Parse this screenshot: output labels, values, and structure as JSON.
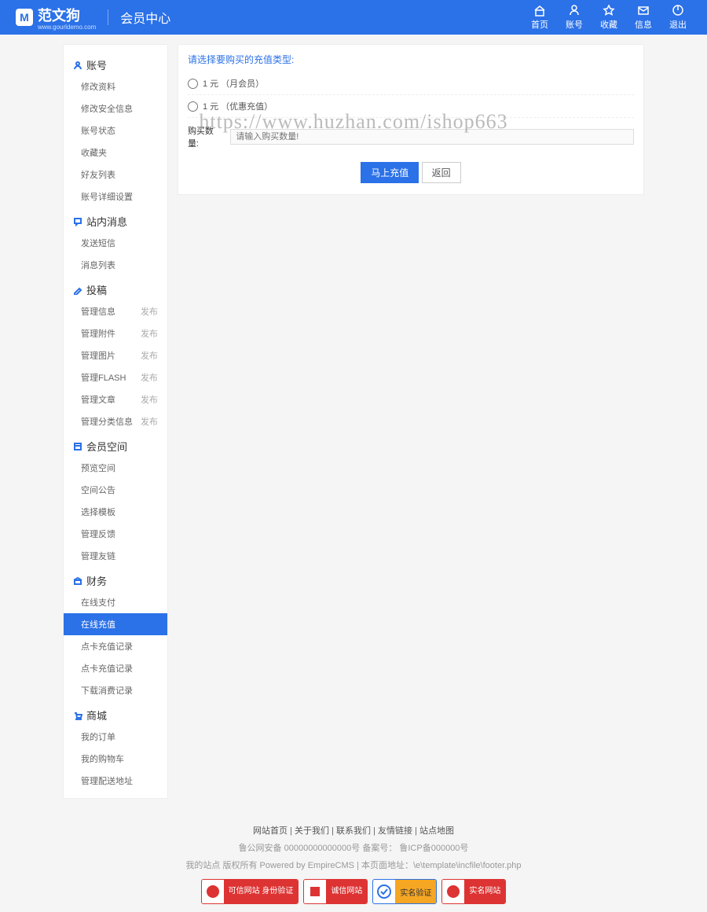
{
  "header": {
    "logo_text": "范文狗",
    "logo_sub": "www.gourldemo.com",
    "page_title": "会员中心",
    "nav": [
      {
        "label": "首页",
        "icon": "home"
      },
      {
        "label": "账号",
        "icon": "user"
      },
      {
        "label": "收藏",
        "icon": "star"
      },
      {
        "label": "信息",
        "icon": "mail"
      },
      {
        "label": "退出",
        "icon": "power"
      }
    ]
  },
  "sidebar": [
    {
      "title": "账号",
      "icon": "user",
      "items": [
        {
          "label": "修改资料"
        },
        {
          "label": "修改安全信息"
        },
        {
          "label": "账号状态"
        },
        {
          "label": "收藏夹"
        },
        {
          "label": "好友列表"
        },
        {
          "label": "账号详细设置"
        }
      ]
    },
    {
      "title": "站内消息",
      "icon": "bubble",
      "items": [
        {
          "label": "发送短信"
        },
        {
          "label": "消息列表"
        }
      ]
    },
    {
      "title": "投稿",
      "icon": "edit",
      "items": [
        {
          "label": "管理信息",
          "action": "发布"
        },
        {
          "label": "管理附件",
          "action": "发布"
        },
        {
          "label": "管理图片",
          "action": "发布"
        },
        {
          "label": "管理FLASH",
          "action": "发布"
        },
        {
          "label": "管理文章",
          "action": "发布"
        },
        {
          "label": "管理分类信息",
          "action": "发布"
        }
      ]
    },
    {
      "title": "会员空间",
      "icon": "layout",
      "items": [
        {
          "label": "预览空间"
        },
        {
          "label": "空间公告"
        },
        {
          "label": "选择模板"
        },
        {
          "label": "管理反馈"
        },
        {
          "label": "管理友链"
        }
      ]
    },
    {
      "title": "财务",
      "icon": "bank",
      "items": [
        {
          "label": "在线支付"
        },
        {
          "label": "在线充值",
          "active": true
        },
        {
          "label": "点卡充值记录"
        },
        {
          "label": "点卡充值记录"
        },
        {
          "label": "下载消费记录"
        }
      ]
    },
    {
      "title": "商城",
      "icon": "cart",
      "items": [
        {
          "label": "我的订单"
        },
        {
          "label": "我的购物车"
        },
        {
          "label": "管理配送地址"
        }
      ]
    }
  ],
  "main": {
    "title": "请选择要购买的充值类型:",
    "options": [
      {
        "label": "1 元  （月会员）"
      },
      {
        "label": "1 元  （优惠充值）"
      }
    ],
    "input_label": "购买数量:",
    "input_placeholder": "请输入购买数量!",
    "btn_submit": "马上充值",
    "btn_back": "返回"
  },
  "footer": {
    "links": [
      "网站首页",
      "关于我们",
      "联系我们",
      "友情链接",
      "站点地图"
    ],
    "beian": "鲁公网安备 00000000000000号 备案号：    鲁ICP备000000号",
    "copy": "我的站点 版权所有 Powered by EmpireCMS | 本页面地址：\\e\\template\\incfile\\footer.php",
    "badges": [
      "可信网站 身份验证",
      "诚信网站",
      "实名验证",
      "实名网站"
    ]
  },
  "watermark": "https://www.huzhan.com/ishop663"
}
